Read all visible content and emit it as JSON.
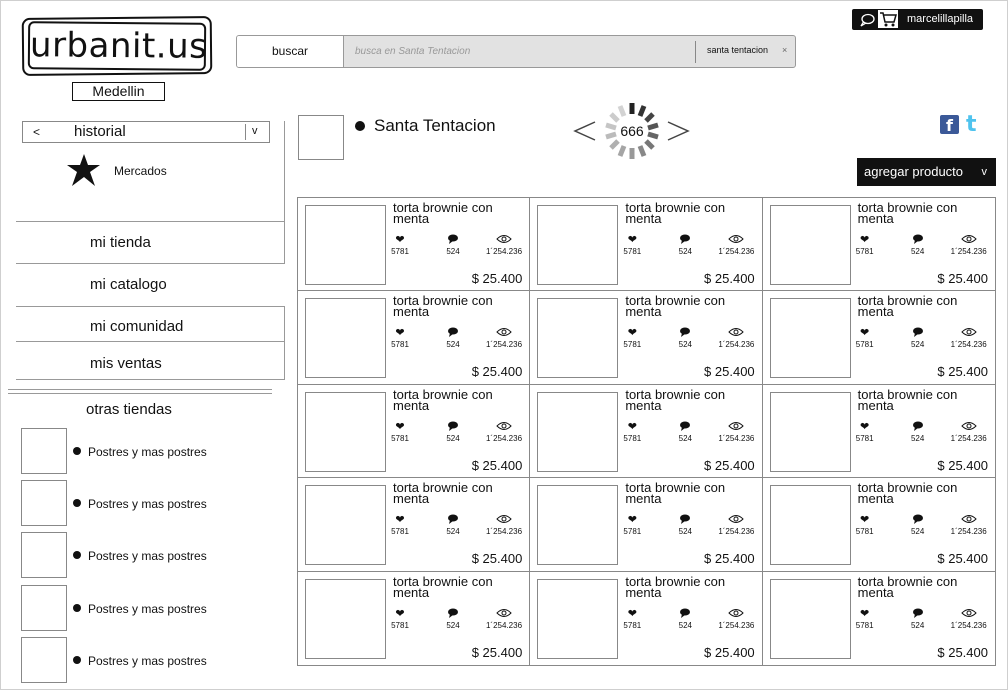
{
  "brand": {
    "logo": "urbanit.us",
    "city": "Medellin"
  },
  "search": {
    "button_label": "buscar",
    "placeholder": "busca en Santa Tentacion",
    "scope": "santa tentacion",
    "clear": "×"
  },
  "user": {
    "name": "marcelillapilla",
    "icons": [
      "chat-icon",
      "cart-icon"
    ]
  },
  "sidebar": {
    "history": {
      "back": "<",
      "label": "historial",
      "dropdown": "v"
    },
    "current": {
      "icon": "star-icon",
      "label": "Mercados"
    },
    "nav": [
      "mi tienda",
      "mi catalogo",
      "mi comunidad",
      "mis ventas"
    ],
    "other_stores_title": "otras tiendas",
    "other_stores": [
      "Postres y mas postres",
      "Postres y mas postres",
      "Postres y mas postres",
      "Postres y mas postres",
      "Postres y mas postres"
    ]
  },
  "store": {
    "name": "Santa Tentacion",
    "counter": "666",
    "prev": "<",
    "next": ">",
    "social": {
      "facebook": "f",
      "twitter": "t"
    },
    "add_product": {
      "label": "agregar producto",
      "chevron": "v"
    }
  },
  "products": [
    {
      "name": "torta brownie con menta",
      "likes": "5781",
      "comments": "524",
      "views": "1´254.236",
      "price": "$ 25.400"
    },
    {
      "name": "torta brownie con menta",
      "likes": "5781",
      "comments": "524",
      "views": "1´254.236",
      "price": "$ 25.400"
    },
    {
      "name": "torta brownie con menta",
      "likes": "5781",
      "comments": "524",
      "views": "1´254.236",
      "price": "$ 25.400"
    },
    {
      "name": "torta brownie con menta",
      "likes": "5781",
      "comments": "524",
      "views": "1´254.236",
      "price": "$ 25.400"
    },
    {
      "name": "torta brownie con menta",
      "likes": "5781",
      "comments": "524",
      "views": "1´254.236",
      "price": "$ 25.400"
    },
    {
      "name": "torta brownie con menta",
      "likes": "5781",
      "comments": "524",
      "views": "1´254.236",
      "price": "$ 25.400"
    },
    {
      "name": "torta brownie con menta",
      "likes": "5781",
      "comments": "524",
      "views": "1´254.236",
      "price": "$ 25.400"
    },
    {
      "name": "torta brownie con menta",
      "likes": "5781",
      "comments": "524",
      "views": "1´254.236",
      "price": "$ 25.400"
    },
    {
      "name": "torta brownie con menta",
      "likes": "5781",
      "comments": "524",
      "views": "1´254.236",
      "price": "$ 25.400"
    },
    {
      "name": "torta brownie con menta",
      "likes": "5781",
      "comments": "524",
      "views": "1´254.236",
      "price": "$ 25.400"
    },
    {
      "name": "torta brownie con menta",
      "likes": "5781",
      "comments": "524",
      "views": "1´254.236",
      "price": "$ 25.400"
    },
    {
      "name": "torta brownie con menta",
      "likes": "5781",
      "comments": "524",
      "views": "1´254.236",
      "price": "$ 25.400"
    },
    {
      "name": "torta brownie con menta",
      "likes": "5781",
      "comments": "524",
      "views": "1´254.236",
      "price": "$ 25.400"
    },
    {
      "name": "torta brownie con menta",
      "likes": "5781",
      "comments": "524",
      "views": "1´254.236",
      "price": "$ 25.400"
    },
    {
      "name": "torta brownie con menta",
      "likes": "5781",
      "comments": "524",
      "views": "1´254.236",
      "price": "$ 25.400"
    }
  ],
  "colors": {
    "facebook": "#3b5998",
    "twitter": "#4fc3ee",
    "dark": "#111111"
  }
}
